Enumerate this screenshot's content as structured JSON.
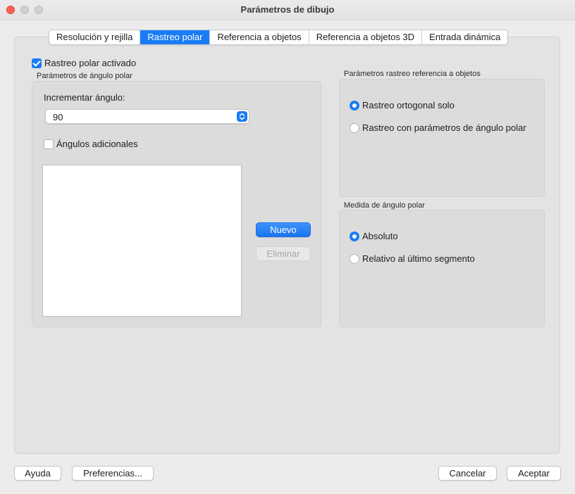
{
  "window": {
    "title": "Parámetros de dibujo"
  },
  "tabs": [
    {
      "label": "Resolución y rejilla",
      "active": false
    },
    {
      "label": "Rastreo polar",
      "active": true
    },
    {
      "label": "Referencia a objetos",
      "active": false
    },
    {
      "label": "Referencia a objetos 3D",
      "active": false
    },
    {
      "label": "Entrada dinámica",
      "active": false
    }
  ],
  "polar": {
    "enabled_label": "Rastreo polar activado",
    "enabled": true,
    "group_title": "Parámetros de ángulo polar",
    "increment_label": "Incrementar ángulo:",
    "increment_value": "90",
    "additional_label": "Ángulos adicionales",
    "additional_checked": false,
    "new_button": "Nuevo",
    "delete_button": "Eliminar"
  },
  "objsnap": {
    "group_title": "Parámetros rastreo referencia a objetos",
    "options": [
      {
        "label": "Rastreo ortogonal solo",
        "selected": true
      },
      {
        "label": "Rastreo con parámetros de ángulo polar",
        "selected": false
      }
    ]
  },
  "measure": {
    "group_title": "Medida de ángulo polar",
    "options": [
      {
        "label": "Absoluto",
        "selected": true
      },
      {
        "label": "Relativo al último segmento",
        "selected": false
      }
    ]
  },
  "footer": {
    "help": "Ayuda",
    "preferences": "Preferencias...",
    "cancel": "Cancelar",
    "accept": "Aceptar"
  },
  "colors": {
    "accent": "#1a7cf5",
    "close": "#fe5f57"
  }
}
